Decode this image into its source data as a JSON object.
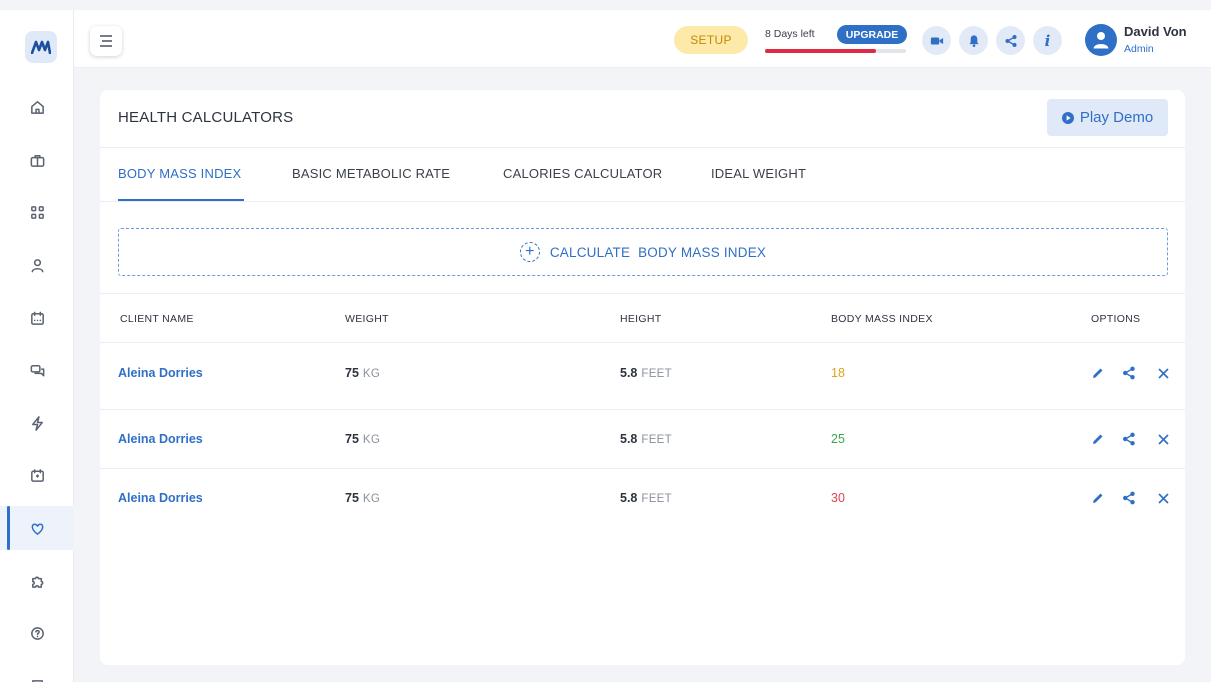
{
  "sidebar": {
    "logo_icon": "m-logo-icon",
    "items": [
      {
        "icon": "home-icon"
      },
      {
        "icon": "briefcase-icon"
      },
      {
        "icon": "apps-icon"
      },
      {
        "icon": "user-icon"
      },
      {
        "icon": "calendar-icon"
      },
      {
        "icon": "chat-icon"
      },
      {
        "icon": "lightning-icon"
      },
      {
        "icon": "schedule-icon"
      },
      {
        "icon": "heart-icon",
        "active": true
      },
      {
        "icon": "puzzle-icon"
      },
      {
        "icon": "help-icon"
      },
      {
        "icon": "building-icon"
      }
    ]
  },
  "topbar": {
    "setup_label": "SETUP",
    "days_left": "8 Days left",
    "upgrade_label": "UPGRADE",
    "trial_progress": 0.79,
    "user_name": "David Von",
    "user_role": "Admin"
  },
  "card": {
    "title": "HEALTH CALCULATORS",
    "demo_label": "Play Demo",
    "tabs": [
      {
        "label": "BODY MASS INDEX",
        "active": true
      },
      {
        "label": "BASIC METABOLIC RATE"
      },
      {
        "label": "CALORIES CALCULATOR"
      },
      {
        "label": "IDEAL WEIGHT"
      }
    ],
    "calculate_label": "CALCULATE  BODY MASS INDEX"
  },
  "table": {
    "headers": [
      "CLIENT NAME",
      "WEIGHT",
      "HEIGHT",
      "BODY MASS INDEX",
      "OPTIONS"
    ],
    "rows": [
      {
        "client": "Aleina Dorries",
        "weight": "75",
        "weight_unit": "KG",
        "height": "5.8",
        "height_unit": "FEET",
        "bmi": "18",
        "bmi_color": "#e0a31c"
      },
      {
        "client": "Aleina Dorries",
        "weight": "75",
        "weight_unit": "KG",
        "height": "5.8",
        "height_unit": "FEET",
        "bmi": "25",
        "bmi_color": "#3aa64b"
      },
      {
        "client": "Aleina Dorries",
        "weight": "75",
        "weight_unit": "KG",
        "height": "5.8",
        "height_unit": "FEET",
        "bmi": "30",
        "bmi_color": "#e0404f"
      }
    ]
  },
  "colors": {
    "accent": "#2f6fc6",
    "setup_bg": "#fde9a8",
    "progress": "#e02947"
  }
}
